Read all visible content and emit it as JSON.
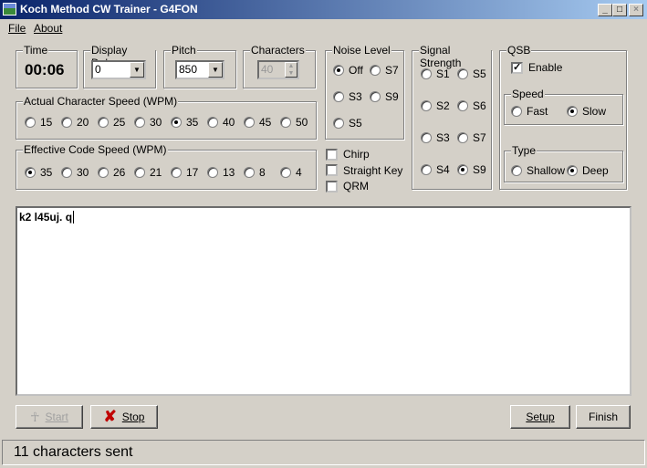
{
  "window": {
    "title": "Koch Method CW Trainer - G4FON",
    "minimize": "_",
    "maximize": "□",
    "close": "×"
  },
  "menu": [
    "File",
    "About"
  ],
  "time": {
    "label": "Time",
    "value": "00:06"
  },
  "display_delay": {
    "label": "Display Delay",
    "value": "0"
  },
  "pitch": {
    "label": "Pitch",
    "value": "850"
  },
  "characters": {
    "label": "Characters",
    "value": "40"
  },
  "actual_speed": {
    "label": "Actual Character Speed (WPM)",
    "options": [
      "15",
      "20",
      "25",
      "30",
      "35",
      "40",
      "45",
      "50"
    ],
    "selected": "35"
  },
  "effective_speed": {
    "label": "Effective Code Speed (WPM)",
    "options": [
      "35",
      "30",
      "26",
      "21",
      "17",
      "13",
      "8",
      "4"
    ],
    "selected": "35"
  },
  "noise": {
    "label": "Noise Level",
    "options": [
      "Off",
      "S7",
      "S3",
      "S9",
      "S5"
    ],
    "selected": "Off"
  },
  "checks": [
    {
      "label": "Chirp",
      "checked": false
    },
    {
      "label": "Straight Key",
      "checked": false
    },
    {
      "label": "QRM",
      "checked": false
    }
  ],
  "signal": {
    "label": "Signal Strength",
    "options": [
      "S1",
      "S5",
      "S2",
      "S6",
      "S3",
      "S7",
      "S4",
      "S9"
    ],
    "selected": "S9"
  },
  "qsb": {
    "label": "QSB",
    "enable_label": "Enable",
    "enable": true,
    "speed": {
      "label": "Speed",
      "options": [
        "Fast",
        "Slow"
      ],
      "selected": "Slow"
    },
    "type": {
      "label": "Type",
      "options": [
        "Shallow",
        "Deep"
      ],
      "selected": "Deep"
    }
  },
  "output_text": "k2 l45uj. q",
  "buttons": {
    "start": "Start",
    "stop": "Stop",
    "setup": "Setup",
    "finish": "Finish"
  },
  "status": "11 characters sent",
  "colors": {
    "title_start": "#0a246a",
    "title_end": "#a6caf0",
    "stop_icon": "#c00000"
  }
}
